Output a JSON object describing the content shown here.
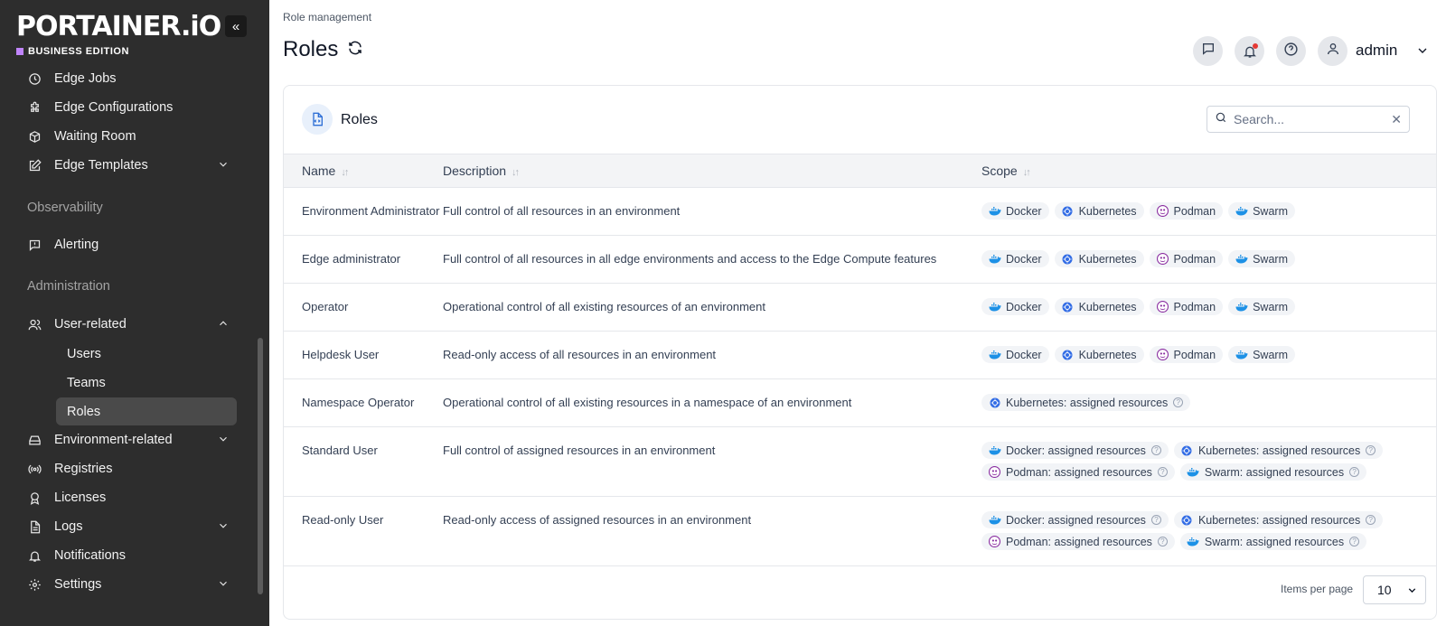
{
  "brand": {
    "logo": "PORTAINER.iO",
    "edition": "BUSINESS EDITION",
    "collapse_glyph": "«"
  },
  "sidebar": {
    "items": [
      {
        "label": "Edge Jobs",
        "icon": "clock-icon"
      },
      {
        "label": "Edge Configurations",
        "icon": "puzzle-icon"
      },
      {
        "label": "Waiting Room",
        "icon": "box-icon"
      },
      {
        "label": "Edge Templates",
        "icon": "edit-icon"
      },
      {
        "label": "Alerting",
        "icon": "message-alert-icon"
      },
      {
        "label": "User-related",
        "icon": "users-icon"
      },
      {
        "label": "Environment-related",
        "icon": "hard-drive-icon"
      },
      {
        "label": "Registries",
        "icon": "radio-icon"
      },
      {
        "label": "Licenses",
        "icon": "award-icon"
      },
      {
        "label": "Logs",
        "icon": "file-text-icon"
      },
      {
        "label": "Notifications",
        "icon": "bell-icon"
      },
      {
        "label": "Settings",
        "icon": "settings-icon"
      }
    ],
    "sections": {
      "observability": "Observability",
      "administration": "Administration"
    },
    "sub_items": [
      "Users",
      "Teams",
      "Roles"
    ],
    "active_sub_item": "Roles"
  },
  "header": {
    "breadcrumb": "Role management",
    "title": "Roles",
    "user": "admin"
  },
  "card": {
    "title": "Roles",
    "search_placeholder": "Search...",
    "columns": [
      "Name",
      "Description",
      "Scope"
    ],
    "items_per_page_label": "Items per page",
    "items_per_page": "10"
  },
  "roles": [
    {
      "name": "Environment Administrator",
      "description": "Full control of all resources in an environment",
      "scope": [
        {
          "label": "Docker",
          "icon": "docker"
        },
        {
          "label": "Kubernetes",
          "icon": "kubernetes"
        },
        {
          "label": "Podman",
          "icon": "podman"
        },
        {
          "label": "Swarm",
          "icon": "docker"
        }
      ]
    },
    {
      "name": "Edge administrator",
      "description": "Full control of all resources in all edge environments and access to the Edge Compute features",
      "scope": [
        {
          "label": "Docker",
          "icon": "docker"
        },
        {
          "label": "Kubernetes",
          "icon": "kubernetes"
        },
        {
          "label": "Podman",
          "icon": "podman"
        },
        {
          "label": "Swarm",
          "icon": "docker"
        }
      ]
    },
    {
      "name": "Operator",
      "description": "Operational control of all existing resources of an environment",
      "scope": [
        {
          "label": "Docker",
          "icon": "docker"
        },
        {
          "label": "Kubernetes",
          "icon": "kubernetes"
        },
        {
          "label": "Podman",
          "icon": "podman"
        },
        {
          "label": "Swarm",
          "icon": "docker"
        }
      ]
    },
    {
      "name": "Helpdesk User",
      "description": "Read-only access of all resources in an environment",
      "scope": [
        {
          "label": "Docker",
          "icon": "docker"
        },
        {
          "label": "Kubernetes",
          "icon": "kubernetes"
        },
        {
          "label": "Podman",
          "icon": "podman"
        },
        {
          "label": "Swarm",
          "icon": "docker"
        }
      ]
    },
    {
      "name": "Namespace Operator",
      "description": "Operational control of all existing resources in a namespace of an environment",
      "scope": [
        {
          "label": "Kubernetes: assigned resources",
          "icon": "kubernetes",
          "help": true
        }
      ]
    },
    {
      "name": "Standard User",
      "description": "Full control of assigned resources in an environment",
      "scope": [
        {
          "label": "Docker: assigned resources",
          "icon": "docker",
          "help": true
        },
        {
          "label": "Kubernetes: assigned resources",
          "icon": "kubernetes",
          "help": true
        },
        {
          "label": "Podman: assigned resources",
          "icon": "podman",
          "help": true
        },
        {
          "label": "Swarm: assigned resources",
          "icon": "docker",
          "help": true
        }
      ]
    },
    {
      "name": "Read-only User",
      "description": "Read-only access of assigned resources in an environment",
      "scope": [
        {
          "label": "Docker: assigned resources",
          "icon": "docker",
          "help": true
        },
        {
          "label": "Kubernetes: assigned resources",
          "icon": "kubernetes",
          "help": true
        },
        {
          "label": "Podman: assigned resources",
          "icon": "podman",
          "help": true
        },
        {
          "label": "Swarm: assigned resources",
          "icon": "docker",
          "help": true
        }
      ]
    }
  ],
  "colors": {
    "sidebar_bg": "#2d2d2d",
    "accent": "#2e6fd6",
    "docker": "#1d91e6",
    "kubernetes": "#326ce5",
    "podman": "#892ca0",
    "notification_dot": "#e53935"
  }
}
